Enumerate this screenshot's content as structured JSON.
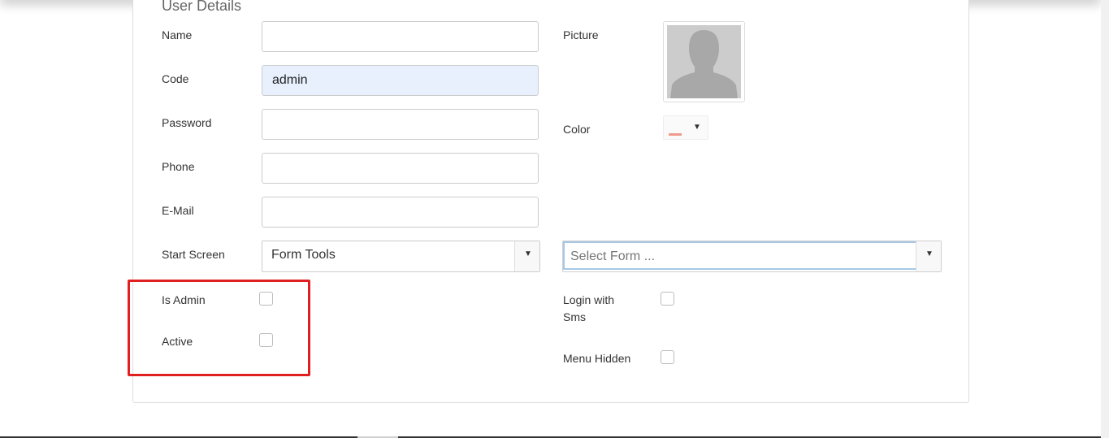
{
  "section_title": "User Details",
  "labels": {
    "name": "Name",
    "code": "Code",
    "password": "Password",
    "phone": "Phone",
    "email": "E-Mail",
    "start_screen": "Start Screen",
    "is_admin": "Is Admin",
    "active": "Active",
    "picture": "Picture",
    "color": "Color",
    "login_with_sms_line1": "Login with",
    "login_with_sms_line2": "Sms",
    "menu_hidden": "Menu Hidden"
  },
  "values": {
    "name": "",
    "code": "admin",
    "password": "",
    "phone": "",
    "email": "",
    "start_screen": "Form Tools",
    "form_select_placeholder": "Select Form ..."
  },
  "checkboxes": {
    "is_admin": false,
    "active": false,
    "login_with_sms": false,
    "menu_hidden": false
  },
  "colors": {
    "highlight_border": "#e02020",
    "color_swatch": "#ef9a8c",
    "autofill_bg": "#e8f0fe",
    "focus_border": "#a6c8e6"
  },
  "icons": {
    "dropdown": "triangle-down",
    "avatar": "person-silhouette"
  }
}
